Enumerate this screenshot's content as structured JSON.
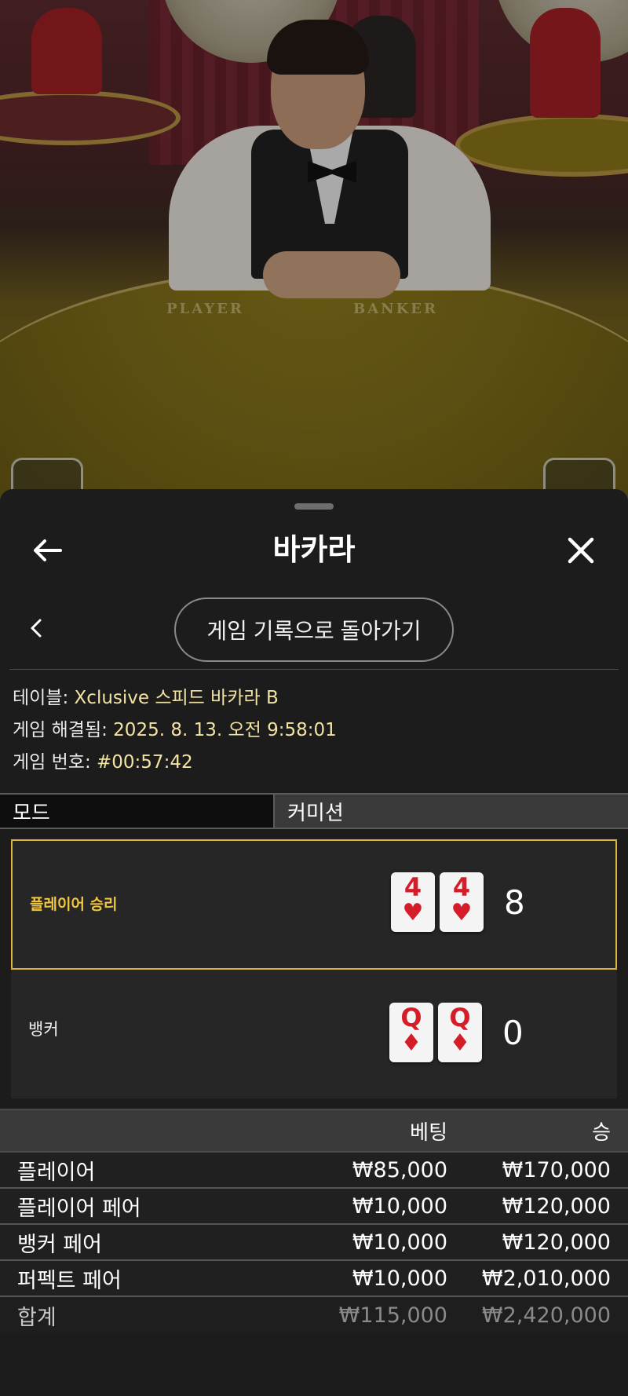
{
  "video": {
    "felt_left": "PLAYER",
    "felt_right": "BANKER"
  },
  "sheet": {
    "title": "바카라",
    "back_icon": "arrow-left-icon",
    "close_icon": "close-x-icon",
    "nav_back_icon": "chevron-left-icon",
    "return_button": "게임 기록으로 돌아가기"
  },
  "info": {
    "table_label": "테이블: ",
    "table_value": "Xclusive 스피드 바카라 B",
    "resolved_label": "게임 해결됨: ",
    "resolved_value": "2025. 8. 13. 오전 9:58:01",
    "game_no_label": "게임 번호: ",
    "game_no_value": "#00:57:42"
  },
  "mode": {
    "label": "모드",
    "value": "커미션"
  },
  "result": {
    "player": {
      "label": "플레이어 승리",
      "cards": [
        {
          "rank": "4",
          "suit": "♥"
        },
        {
          "rank": "4",
          "suit": "♥"
        }
      ],
      "score": "8"
    },
    "banker": {
      "label": "뱅커",
      "cards": [
        {
          "rank": "Q",
          "suit": "♦"
        },
        {
          "rank": "Q",
          "suit": "♦"
        }
      ],
      "score": "0"
    }
  },
  "bets": {
    "headers": {
      "bet": "베팅",
      "win": "승"
    },
    "rows": [
      {
        "name": "플레이어",
        "bet": "₩85,000",
        "win": "₩170,000"
      },
      {
        "name": "플레이어 페어",
        "bet": "₩10,000",
        "win": "₩120,000"
      },
      {
        "name": "뱅커 페어",
        "bet": "₩10,000",
        "win": "₩120,000"
      },
      {
        "name": "퍼펙트 페어",
        "bet": "₩10,000",
        "win": "₩2,010,000"
      }
    ],
    "total": {
      "name": "합계",
      "bet": "₩115,000",
      "win": "₩2,420,000"
    }
  },
  "colors": {
    "accent": "#f1c640",
    "card_red": "#d51d2a",
    "info_value": "#f3e3a3"
  }
}
